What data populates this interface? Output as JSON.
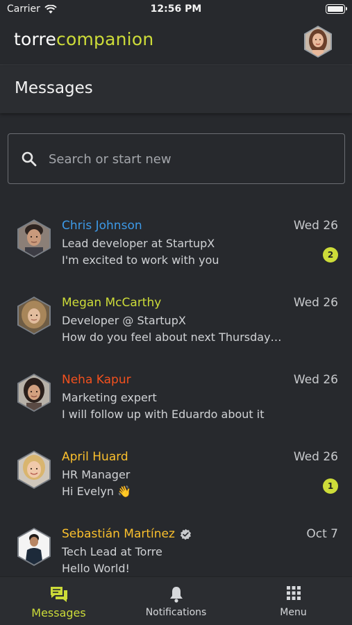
{
  "status_bar": {
    "carrier": "Carrier",
    "time": "12:56 PM"
  },
  "header": {
    "logo_part1": "torre",
    "logo_part2": "companion"
  },
  "page": {
    "title": "Messages"
  },
  "search": {
    "placeholder": "Search or start new"
  },
  "conversations": [
    {
      "name": "Chris Johnson",
      "name_color": "#3d9ae8",
      "subtitle": "Lead developer at StartupX",
      "preview": "I'm excited to work with you",
      "date": "Wed 26",
      "unread": "2",
      "verified": false
    },
    {
      "name": "Megan McCarthy",
      "name_color": "#cddc39",
      "subtitle": "Developer @ StartupX",
      "preview": "How do you feel about next Thursday ...",
      "date": "Wed 26",
      "unread": "",
      "verified": false
    },
    {
      "name": "Neha Kapur",
      "name_color": "#f4511e",
      "subtitle": "Marketing expert",
      "preview": "I will follow up with Eduardo about it",
      "date": "Wed 26",
      "unread": "",
      "verified": false
    },
    {
      "name": "April Huard",
      "name_color": "#fbc02d",
      "subtitle": "HR Manager",
      "preview": "Hi Evelyn 👋",
      "date": "Wed 26",
      "unread": "1",
      "verified": false
    },
    {
      "name": "Sebastián Martínez",
      "name_color": "#fbc02d",
      "subtitle": "Tech Lead at Torre",
      "preview": "Hello World!",
      "date": "Oct 7",
      "unread": "",
      "verified": true
    }
  ],
  "bottom_nav": [
    {
      "label": "Messages",
      "icon": "chat-icon",
      "active": true
    },
    {
      "label": "Notifications",
      "icon": "bell-icon",
      "active": false
    },
    {
      "label": "Menu",
      "icon": "grid-icon",
      "active": false
    }
  ],
  "colors": {
    "accent": "#cddc39",
    "background": "#27292d"
  }
}
